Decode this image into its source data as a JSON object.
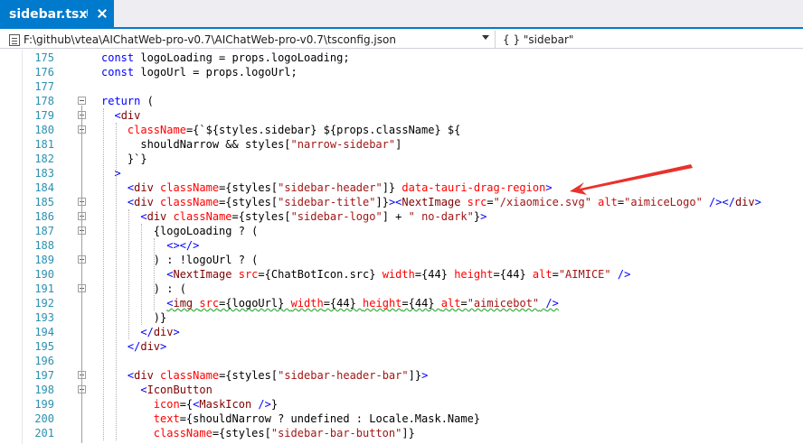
{
  "tab": {
    "title": "sidebar.tsx",
    "pin_glyph": "⊣"
  },
  "nav": {
    "path": "F:\\github\\vtea\\AIChatWeb-pro-v0.7\\AIChatWeb-pro-v0.7\\tsconfig.json",
    "scope": "{ } \"sidebar\""
  },
  "lines": [
    {
      "n": "175",
      "fold": false,
      "tokens": [
        [
          "kw",
          "const "
        ],
        [
          "tx",
          "logoLoading = props.logoLoading;"
        ]
      ]
    },
    {
      "n": "176",
      "fold": false,
      "tokens": [
        [
          "kw",
          "const "
        ],
        [
          "tx",
          "logoUrl = props.logoUrl;"
        ]
      ]
    },
    {
      "n": "177",
      "fold": false,
      "tokens": []
    },
    {
      "n": "178",
      "fold": true,
      "tokens": [
        [
          "kw",
          "return "
        ],
        [
          "tx",
          "("
        ]
      ]
    },
    {
      "n": "179",
      "fold": true,
      "tokens": [
        [
          "tx",
          "  "
        ],
        [
          "pu",
          "<"
        ],
        [
          "tg",
          "div"
        ]
      ]
    },
    {
      "n": "180",
      "fold": true,
      "tokens": [
        [
          "tx",
          "    "
        ],
        [
          "at",
          "className"
        ],
        [
          "tx",
          "={`${styles.sidebar} ${props.className} ${"
        ]
      ]
    },
    {
      "n": "181",
      "fold": false,
      "tokens": [
        [
          "tx",
          "      shouldNarrow && styles["
        ],
        [
          "st",
          "\"narrow-sidebar\""
        ],
        [
          "tx",
          "]"
        ]
      ]
    },
    {
      "n": "182",
      "fold": false,
      "tokens": [
        [
          "tx",
          "    }`}"
        ]
      ]
    },
    {
      "n": "183",
      "fold": false,
      "tokens": [
        [
          "tx",
          "  "
        ],
        [
          "pu",
          ">"
        ]
      ]
    },
    {
      "n": "184",
      "fold": false,
      "tokens": [
        [
          "tx",
          "    "
        ],
        [
          "pu",
          "<"
        ],
        [
          "tg",
          "div "
        ],
        [
          "at",
          "className"
        ],
        [
          "tx",
          "={styles["
        ],
        [
          "st",
          "\"sidebar-header\""
        ],
        [
          "tx",
          "]} "
        ],
        [
          "at",
          "data-tauri-drag-region"
        ],
        [
          "pu",
          ">"
        ]
      ]
    },
    {
      "n": "185",
      "fold": true,
      "tokens": [
        [
          "tx",
          "    "
        ],
        [
          "pu",
          "<"
        ],
        [
          "tg",
          "div "
        ],
        [
          "at",
          "className"
        ],
        [
          "tx",
          "={styles["
        ],
        [
          "st",
          "\"sidebar-title\""
        ],
        [
          "tx",
          "]}"
        ],
        [
          "pu",
          "><"
        ],
        [
          "tg",
          "NextImage "
        ],
        [
          "at",
          "src"
        ],
        [
          "tx",
          "="
        ],
        [
          "st",
          "\"/xiaomice.svg\""
        ],
        [
          "tx",
          " "
        ],
        [
          "at",
          "alt"
        ],
        [
          "tx",
          "="
        ],
        [
          "st",
          "\"aimiceLogo\""
        ],
        [
          "tx",
          " "
        ],
        [
          "pu",
          "/></"
        ],
        [
          "tg",
          "div"
        ],
        [
          "pu",
          ">"
        ]
      ]
    },
    {
      "n": "186",
      "fold": true,
      "tokens": [
        [
          "tx",
          "      "
        ],
        [
          "pu",
          "<"
        ],
        [
          "tg",
          "div "
        ],
        [
          "at",
          "className"
        ],
        [
          "tx",
          "={styles["
        ],
        [
          "st",
          "\"sidebar-logo\""
        ],
        [
          "tx",
          "] + "
        ],
        [
          "st",
          "\" no-dark\""
        ],
        [
          "tx",
          "}"
        ],
        [
          "pu",
          ">"
        ]
      ]
    },
    {
      "n": "187",
      "fold": true,
      "tokens": [
        [
          "tx",
          "        {logoLoading ? ("
        ]
      ]
    },
    {
      "n": "188",
      "fold": false,
      "tokens": [
        [
          "tx",
          "          "
        ],
        [
          "pu",
          "<></>"
        ]
      ]
    },
    {
      "n": "189",
      "fold": true,
      "tokens": [
        [
          "tx",
          "        ) : !logoUrl ? ("
        ]
      ]
    },
    {
      "n": "190",
      "fold": false,
      "tokens": [
        [
          "tx",
          "          "
        ],
        [
          "pu",
          "<"
        ],
        [
          "tg",
          "NextImage "
        ],
        [
          "at",
          "src"
        ],
        [
          "tx",
          "={ChatBotIcon.src} "
        ],
        [
          "at",
          "width"
        ],
        [
          "tx",
          "={44} "
        ],
        [
          "at",
          "height"
        ],
        [
          "tx",
          "={44} "
        ],
        [
          "at",
          "alt"
        ],
        [
          "tx",
          "="
        ],
        [
          "st",
          "\"AIMICE\""
        ],
        [
          "tx",
          " "
        ],
        [
          "pu",
          "/>"
        ]
      ]
    },
    {
      "n": "191",
      "fold": true,
      "tokens": [
        [
          "tx",
          "        ) : ("
        ]
      ]
    },
    {
      "n": "192",
      "fold": false,
      "squiggle": true,
      "tokens": [
        [
          "tx",
          "          "
        ],
        [
          "pu",
          "<"
        ],
        [
          "tg",
          "img "
        ],
        [
          "at",
          "src"
        ],
        [
          "tx",
          "={logoUrl} "
        ],
        [
          "at",
          "width"
        ],
        [
          "tx",
          "={44} "
        ],
        [
          "at",
          "height"
        ],
        [
          "tx",
          "={44} "
        ],
        [
          "at",
          "alt"
        ],
        [
          "tx",
          "="
        ],
        [
          "st",
          "\"aimicebot\""
        ],
        [
          "tx",
          " "
        ],
        [
          "pu",
          "/>"
        ]
      ]
    },
    {
      "n": "193",
      "fold": false,
      "tokens": [
        [
          "tx",
          "        )}"
        ]
      ]
    },
    {
      "n": "194",
      "fold": false,
      "tokens": [
        [
          "tx",
          "      "
        ],
        [
          "pu",
          "</"
        ],
        [
          "tg",
          "div"
        ],
        [
          "pu",
          ">"
        ]
      ]
    },
    {
      "n": "195",
      "fold": false,
      "tokens": [
        [
          "tx",
          "    "
        ],
        [
          "pu",
          "</"
        ],
        [
          "tg",
          "div"
        ],
        [
          "pu",
          ">"
        ]
      ]
    },
    {
      "n": "196",
      "fold": false,
      "tokens": []
    },
    {
      "n": "197",
      "fold": true,
      "tokens": [
        [
          "tx",
          "    "
        ],
        [
          "pu",
          "<"
        ],
        [
          "tg",
          "div "
        ],
        [
          "at",
          "className"
        ],
        [
          "tx",
          "={styles["
        ],
        [
          "st",
          "\"sidebar-header-bar\""
        ],
        [
          "tx",
          "]}"
        ],
        [
          "pu",
          ">"
        ]
      ]
    },
    {
      "n": "198",
      "fold": true,
      "tokens": [
        [
          "tx",
          "      "
        ],
        [
          "pu",
          "<"
        ],
        [
          "tg",
          "IconButton"
        ]
      ]
    },
    {
      "n": "199",
      "fold": false,
      "tokens": [
        [
          "tx",
          "        "
        ],
        [
          "at",
          "icon"
        ],
        [
          "tx",
          "={"
        ],
        [
          "pu",
          "<"
        ],
        [
          "tg",
          "MaskIcon "
        ],
        [
          "pu",
          "/>"
        ],
        [
          "tx",
          "}"
        ]
      ]
    },
    {
      "n": "200",
      "fold": false,
      "tokens": [
        [
          "tx",
          "        "
        ],
        [
          "at",
          "text"
        ],
        [
          "tx",
          "={shouldNarrow ? undefined : Locale.Mask.Name}"
        ]
      ]
    },
    {
      "n": "201",
      "fold": false,
      "tokens": [
        [
          "tx",
          "        "
        ],
        [
          "at",
          "className"
        ],
        [
          "tx",
          "={styles["
        ],
        [
          "st",
          "\"sidebar-bar-button\""
        ],
        [
          "tx",
          "]}"
        ]
      ]
    }
  ],
  "colors": {
    "accent": "#007acc",
    "arrow": "#e8322d"
  }
}
